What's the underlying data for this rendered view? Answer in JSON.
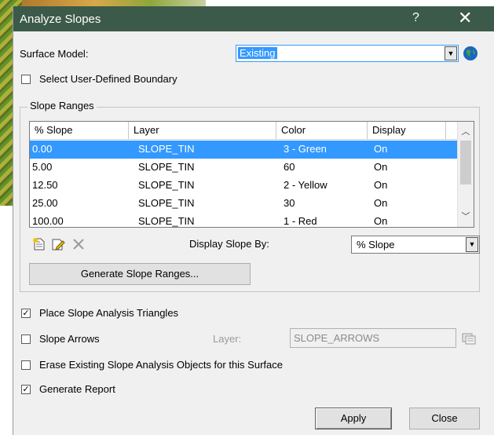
{
  "window": {
    "title": "Analyze Slopes",
    "help_label": "?",
    "close_label": "✕"
  },
  "surface_model": {
    "label": "Surface Model:",
    "value": "Existing",
    "icon": "globe-icon"
  },
  "boundary": {
    "label": "Select User-Defined Boundary",
    "checked": false
  },
  "slope_ranges": {
    "group_title": "Slope Ranges",
    "columns": [
      "% Slope",
      "Layer",
      "Color",
      "Display"
    ],
    "rows": [
      {
        "slope": "0.00",
        "layer": "SLOPE_TIN",
        "color": "3 - Green",
        "display": "On",
        "selected": true
      },
      {
        "slope": "5.00",
        "layer": "SLOPE_TIN",
        "color": "60",
        "display": "On",
        "selected": false
      },
      {
        "slope": "12.50",
        "layer": "SLOPE_TIN",
        "color": "2 - Yellow",
        "display": "On",
        "selected": false
      },
      {
        "slope": "25.00",
        "layer": "SLOPE_TIN",
        "color": "30",
        "display": "On",
        "selected": false
      },
      {
        "slope": "100.00",
        "layer": "SLOPE_TIN",
        "color": "1 - Red",
        "display": "On",
        "selected": false
      }
    ],
    "tools": [
      "new-range-icon",
      "edit-range-icon",
      "delete-range-icon"
    ],
    "display_by_label": "Display Slope By:",
    "display_by_value": "% Slope",
    "generate_button": "Generate Slope Ranges..."
  },
  "options": {
    "place_triangles": {
      "label": "Place Slope Analysis Triangles",
      "checked": true
    },
    "slope_arrows": {
      "label": "Slope Arrows",
      "checked": false
    },
    "layer_label": "Layer:",
    "layer_value": "SLOPE_ARROWS",
    "erase_existing": {
      "label": "Erase Existing Slope Analysis Objects for this Surface",
      "checked": false
    },
    "generate_report": {
      "label": "Generate Report",
      "checked": true
    }
  },
  "buttons": {
    "apply": "Apply",
    "close": "Close"
  },
  "colors": {
    "titlebar": "#3c5a49",
    "selection": "#3399ff"
  }
}
